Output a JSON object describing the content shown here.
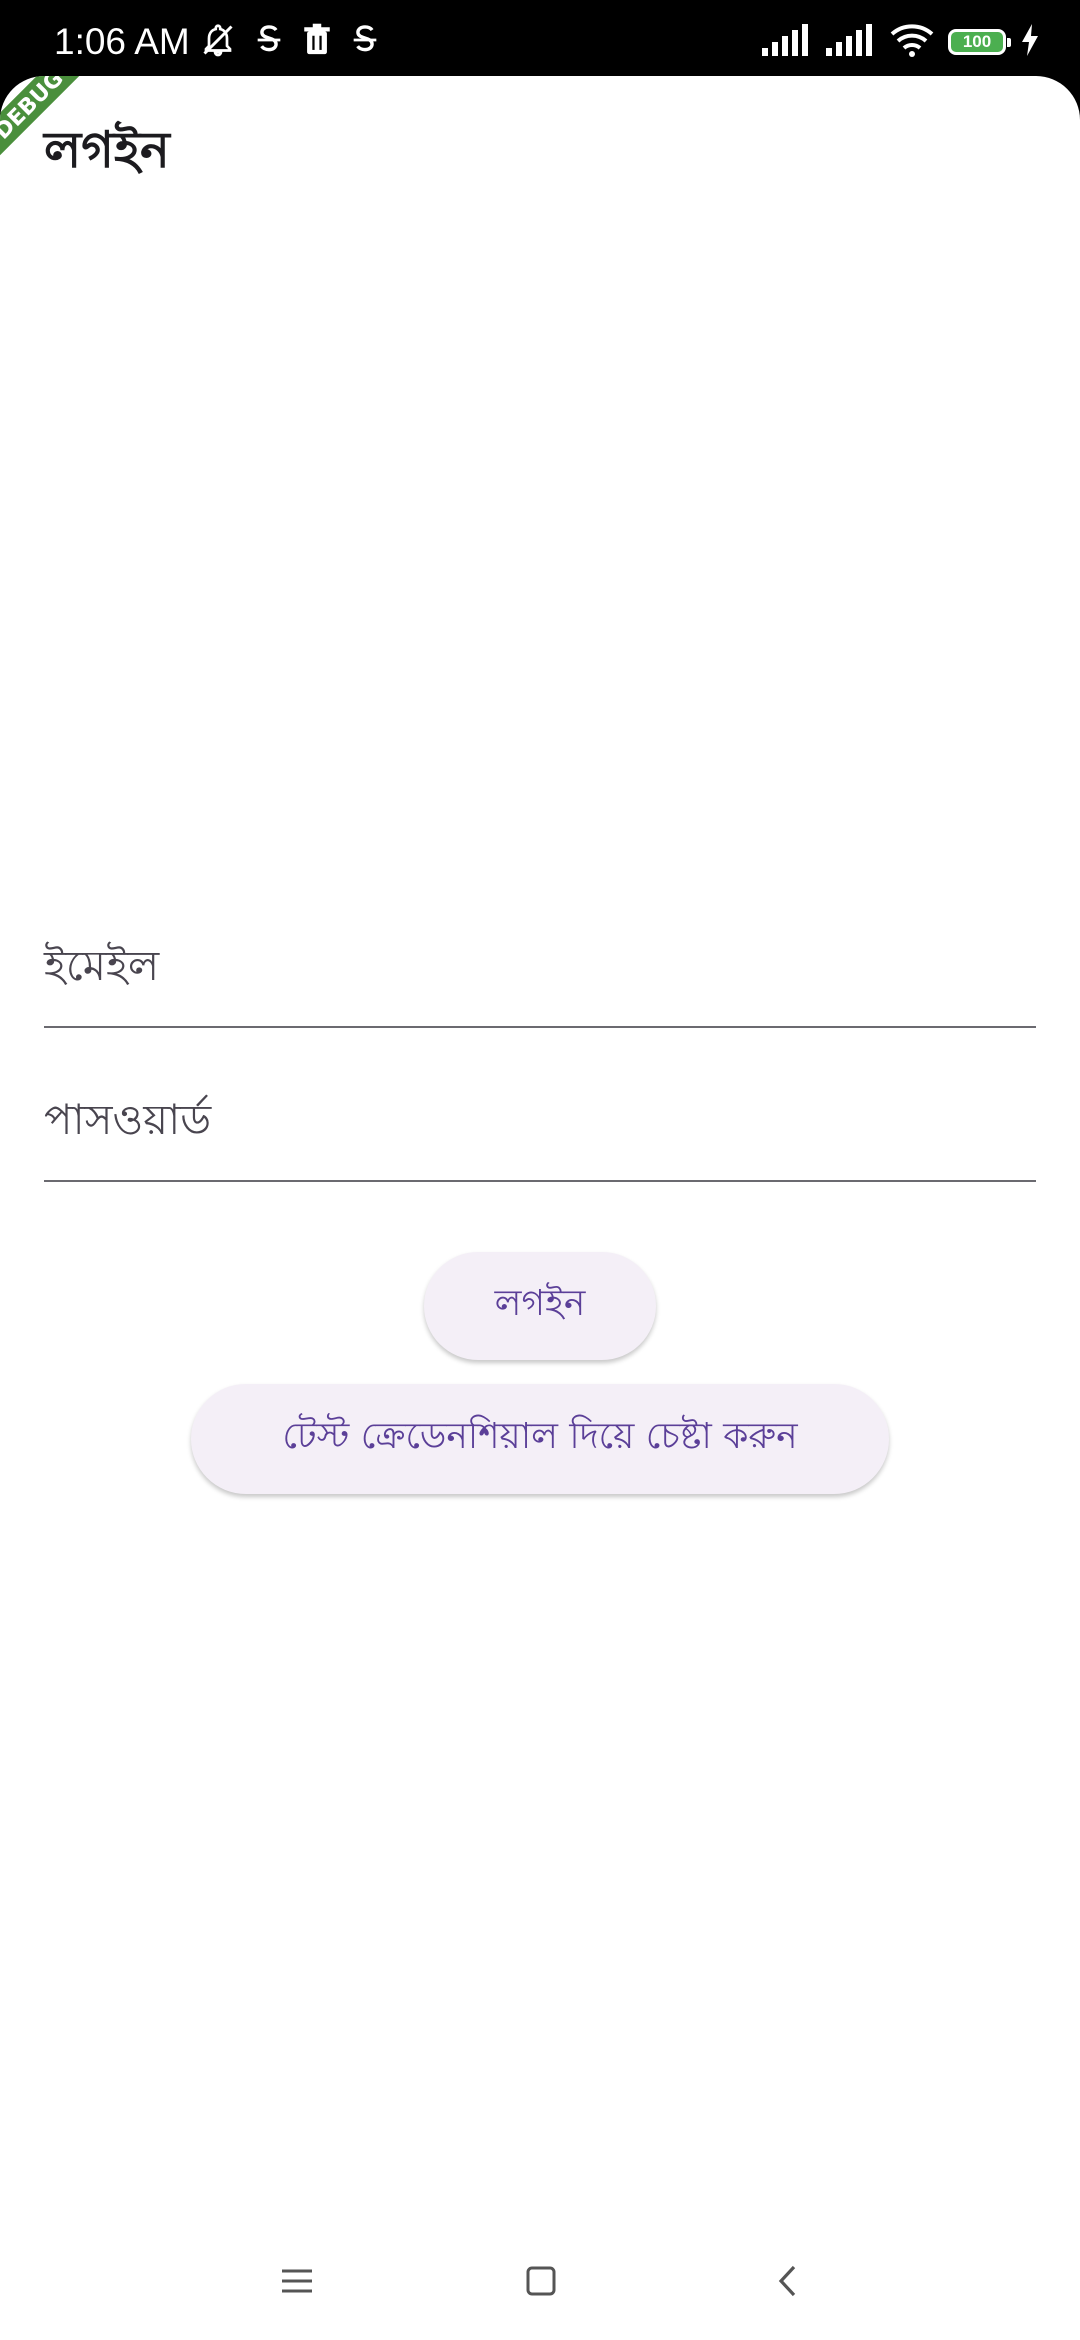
{
  "status_bar": {
    "time": "1:06 AM",
    "battery_level": "100",
    "icons": [
      "notifications-off-icon",
      "s-app-icon",
      "trash-icon",
      "s-app-icon",
      "signal-icon",
      "signal-icon",
      "wifi-icon",
      "battery-icon",
      "charging-icon"
    ]
  },
  "app": {
    "debug_banner": "DEBUG",
    "title": "লগইন"
  },
  "form": {
    "email_label": "ইমেইল",
    "password_label": "পাসওয়ার্ড"
  },
  "buttons": {
    "login_label": "লগইন",
    "test_credentials_label": "টেস্ট ক্রেডেনশিয়াল দিয়ে চেষ্টা করুন"
  },
  "nav_bar": {
    "items": [
      "menu-icon",
      "home-icon",
      "back-icon"
    ]
  },
  "colors": {
    "button_bg": "#f4eff7",
    "button_text": "#5b3f98",
    "debug_banner": "#4a8f3c",
    "battery": "#4caf50"
  }
}
